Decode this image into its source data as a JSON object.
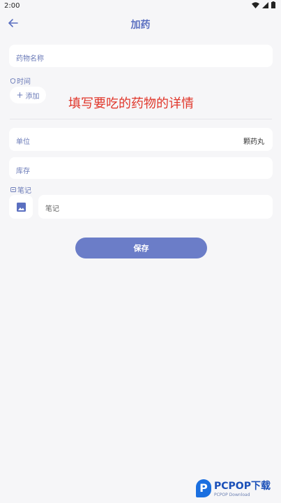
{
  "status": {
    "time": "2:00"
  },
  "appbar": {
    "title": "加药"
  },
  "form": {
    "medicine_name_placeholder": "药物名称",
    "time_label": "时间",
    "add_label": "添加",
    "unit_label": "单位",
    "unit_value": "颗药丸",
    "stock_label": "库存",
    "notes_label": "笔记",
    "notes_placeholder": "笔记",
    "save_label": "保存"
  },
  "annotation": "填写要吃的药物的详情",
  "watermark": {
    "brand": "PCPOP下载",
    "sub": "PCPOP Download"
  },
  "colors": {
    "accent": "#6b7dc8",
    "annotation": "#e0362a",
    "background": "#f6f6f8"
  }
}
